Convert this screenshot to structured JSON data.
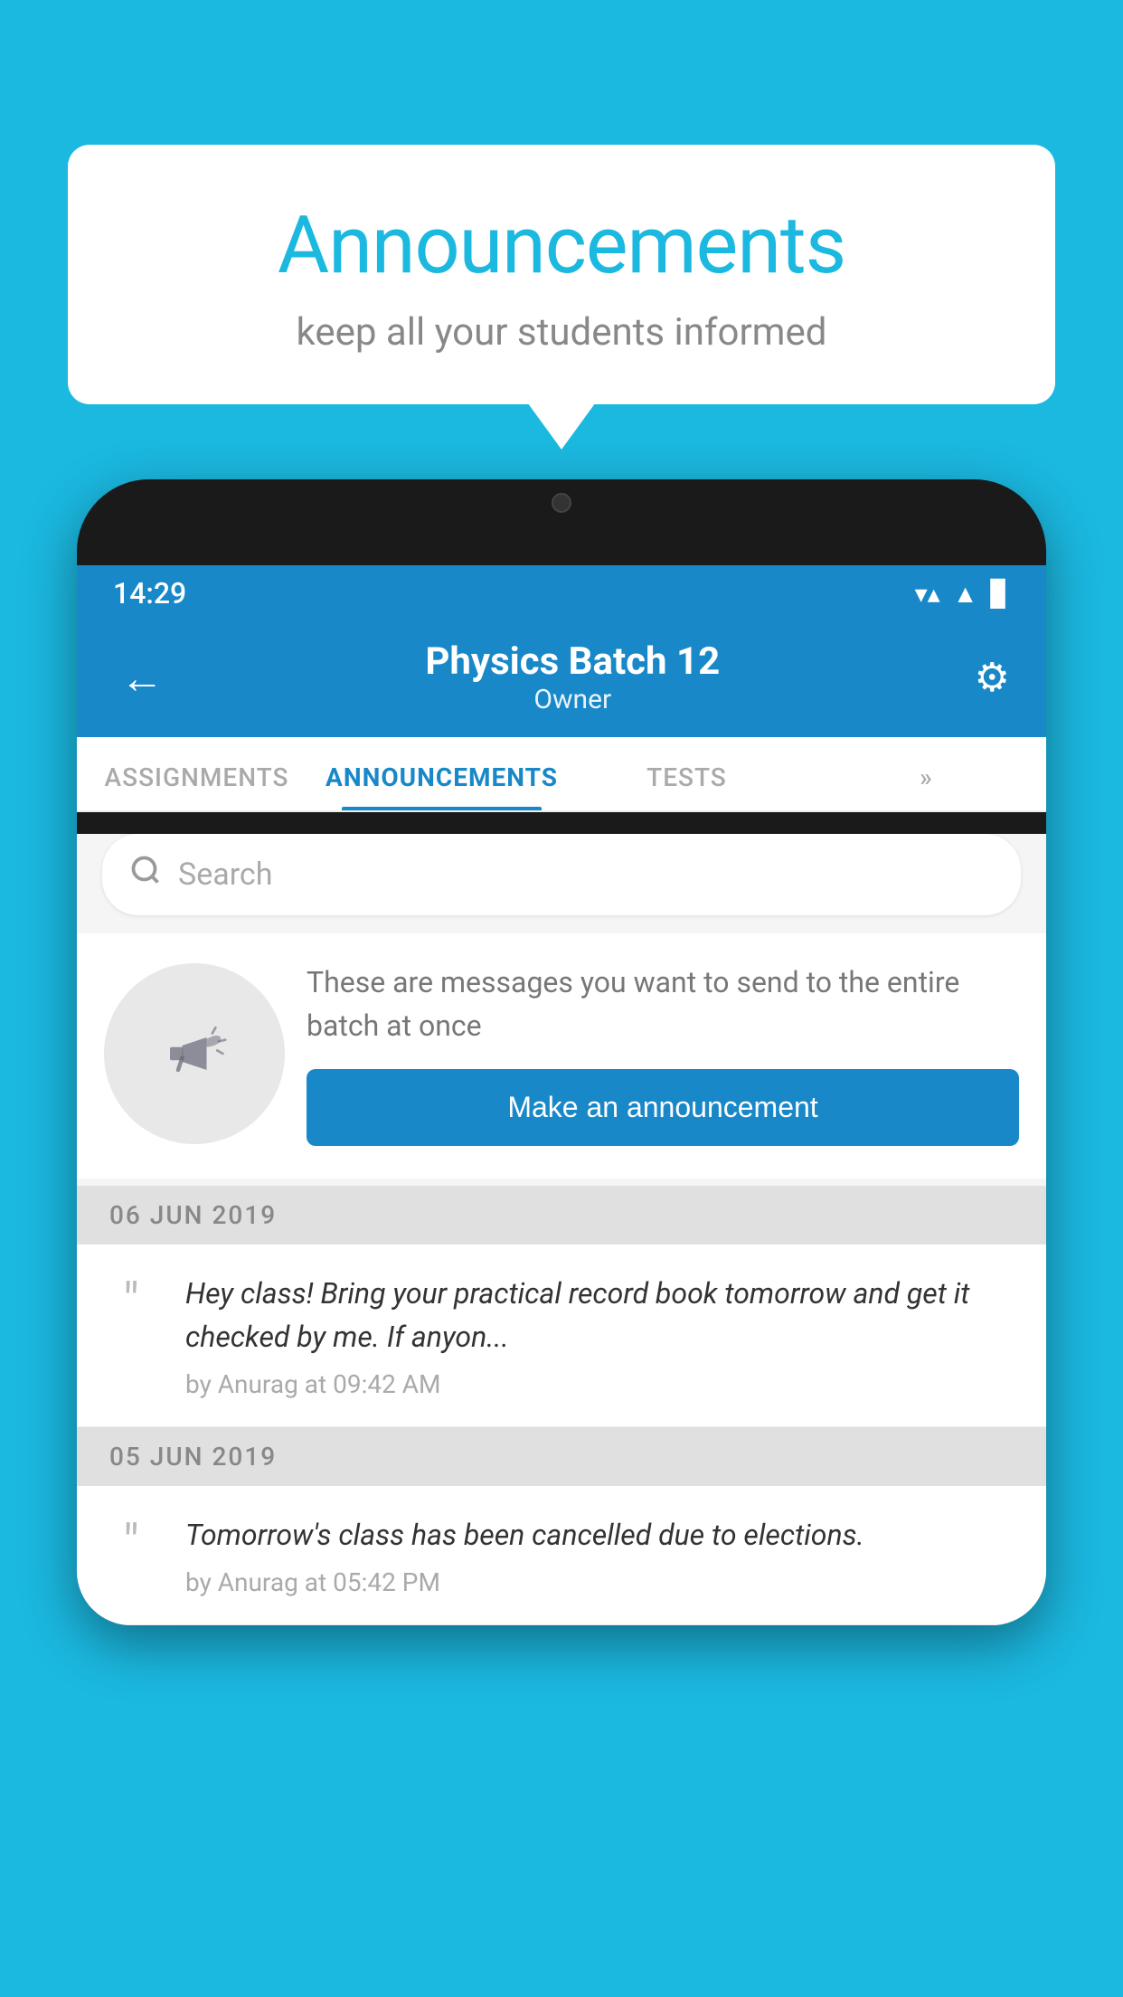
{
  "background_color": "#1bb8e0",
  "speech_bubble": {
    "title": "Announcements",
    "subtitle": "keep all your students informed"
  },
  "phone": {
    "status_bar": {
      "time": "14:29",
      "wifi_icon": "▼",
      "signal_icon": "▲",
      "battery_icon": "▊"
    },
    "header": {
      "back_label": "←",
      "title": "Physics Batch 12",
      "subtitle": "Owner",
      "settings_icon": "⚙"
    },
    "tabs": [
      {
        "label": "ASSIGNMENTS",
        "active": false
      },
      {
        "label": "ANNOUNCEMENTS",
        "active": true
      },
      {
        "label": "TESTS",
        "active": false
      },
      {
        "label": "»",
        "active": false
      }
    ],
    "search": {
      "placeholder": "Search",
      "icon": "🔍"
    },
    "promo": {
      "description": "These are messages you want to send to the entire batch at once",
      "button_label": "Make an announcement"
    },
    "announcements": [
      {
        "date": "06  JUN  2019",
        "message": "Hey class! Bring your practical record book tomorrow and get it checked by me. If anyon...",
        "meta": "by Anurag at 09:42 AM"
      },
      {
        "date": "05  JUN  2019",
        "message": "Tomorrow's class has been cancelled due to elections.",
        "meta": "by Anurag at 05:42 PM"
      }
    ]
  }
}
